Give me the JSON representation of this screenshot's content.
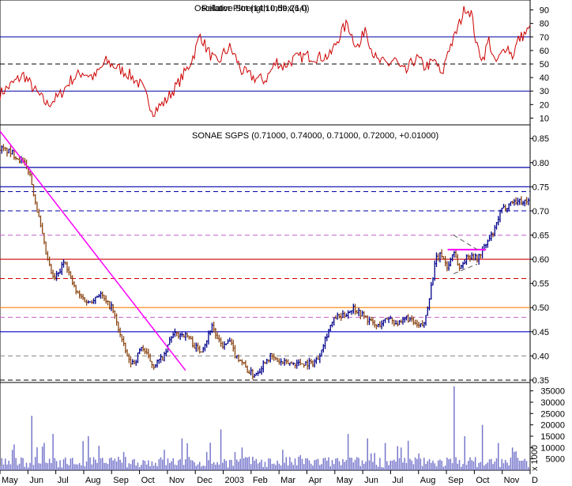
{
  "chart_data": [
    {
      "panel": "rsi",
      "type": "line",
      "title": "Relative Strength Index(14)",
      "title_overlay": "Oscillator Plot (14,10,59,26,0)",
      "ylim": [
        5,
        95
      ],
      "yticks": [
        "90",
        "80",
        "70",
        "60",
        "50",
        "40",
        "30",
        "20",
        "10"
      ],
      "hlines": [
        {
          "y": 70,
          "style": "solid",
          "color": "#0000aa"
        },
        {
          "y": 50,
          "style": "dashed",
          "color": "#000000"
        },
        {
          "y": 30,
          "style": "solid",
          "color": "#0000aa"
        }
      ],
      "color": "#cc0000",
      "key_points": [
        [
          0,
          28
        ],
        [
          4,
          35
        ],
        [
          8,
          42
        ],
        [
          12,
          30
        ],
        [
          16,
          20
        ],
        [
          20,
          26
        ],
        [
          24,
          38
        ],
        [
          28,
          44
        ],
        [
          32,
          40
        ],
        [
          36,
          52
        ],
        [
          40,
          47
        ],
        [
          44,
          42
        ],
        [
          48,
          34
        ],
        [
          52,
          15
        ],
        [
          56,
          22
        ],
        [
          60,
          34
        ],
        [
          64,
          48
        ],
        [
          66,
          58
        ],
        [
          68,
          72
        ],
        [
          70,
          62
        ],
        [
          72,
          55
        ],
        [
          74,
          50
        ],
        [
          76,
          58
        ],
        [
          78,
          62
        ],
        [
          80,
          55
        ],
        [
          82,
          45
        ],
        [
          86,
          40
        ],
        [
          90,
          38
        ],
        [
          94,
          52
        ],
        [
          96,
          48
        ],
        [
          100,
          54
        ],
        [
          104,
          56
        ],
        [
          108,
          55
        ],
        [
          112,
          56
        ],
        [
          116,
          74
        ],
        [
          118,
          80
        ],
        [
          120,
          68
        ],
        [
          122,
          62
        ],
        [
          124,
          78
        ],
        [
          126,
          62
        ],
        [
          128,
          52
        ],
        [
          132,
          50
        ],
        [
          134,
          54
        ],
        [
          136,
          46
        ],
        [
          138,
          44
        ],
        [
          140,
          52
        ],
        [
          142,
          54
        ],
        [
          144,
          48
        ],
        [
          148,
          52
        ],
        [
          150,
          40
        ],
        [
          152,
          60
        ],
        [
          154,
          68
        ],
        [
          156,
          80
        ],
        [
          158,
          92
        ],
        [
          160,
          88
        ],
        [
          162,
          62
        ],
        [
          164,
          54
        ],
        [
          166,
          68
        ],
        [
          168,
          50
        ],
        [
          170,
          56
        ],
        [
          172,
          64
        ],
        [
          174,
          56
        ],
        [
          176,
          68
        ],
        [
          178,
          72
        ],
        [
          180,
          76
        ]
      ]
    },
    {
      "panel": "price",
      "type": "ohlc",
      "title": "SONAE SGPS (0.71000, 0.74000, 0.71000, 0.72000, +0.01000)",
      "ylim": [
        0.345,
        0.865
      ],
      "yticks": [
        "0.85",
        "0.80",
        "0.75",
        "0.70",
        "0.65",
        "0.60",
        "0.55",
        "0.50",
        "0.45",
        "0.40",
        "0.35"
      ],
      "up_color": "#00008b",
      "down_color": "#8b4513",
      "key_points": [
        [
          0,
          0.83
        ],
        [
          4,
          0.82
        ],
        [
          8,
          0.8
        ],
        [
          10,
          0.78
        ],
        [
          12,
          0.72
        ],
        [
          14,
          0.66
        ],
        [
          16,
          0.6
        ],
        [
          18,
          0.56
        ],
        [
          20,
          0.57
        ],
        [
          22,
          0.6
        ],
        [
          24,
          0.56
        ],
        [
          26,
          0.53
        ],
        [
          28,
          0.52
        ],
        [
          30,
          0.51
        ],
        [
          32,
          0.52
        ],
        [
          34,
          0.53
        ],
        [
          36,
          0.51
        ],
        [
          38,
          0.5
        ],
        [
          40,
          0.46
        ],
        [
          42,
          0.42
        ],
        [
          44,
          0.385
        ],
        [
          46,
          0.39
        ],
        [
          48,
          0.42
        ],
        [
          50,
          0.4
        ],
        [
          52,
          0.38
        ],
        [
          54,
          0.39
        ],
        [
          56,
          0.4
        ],
        [
          58,
          0.44
        ],
        [
          60,
          0.445
        ],
        [
          62,
          0.445
        ],
        [
          64,
          0.44
        ],
        [
          66,
          0.42
        ],
        [
          68,
          0.41
        ],
        [
          70,
          0.43
        ],
        [
          72,
          0.465
        ],
        [
          74,
          0.43
        ],
        [
          76,
          0.42
        ],
        [
          78,
          0.43
        ],
        [
          80,
          0.4
        ],
        [
          82,
          0.39
        ],
        [
          84,
          0.37
        ],
        [
          86,
          0.36
        ],
        [
          88,
          0.37
        ],
        [
          90,
          0.39
        ],
        [
          92,
          0.4
        ],
        [
          94,
          0.39
        ],
        [
          96,
          0.385
        ],
        [
          98,
          0.385
        ],
        [
          100,
          0.385
        ],
        [
          102,
          0.385
        ],
        [
          104,
          0.385
        ],
        [
          106,
          0.385
        ],
        [
          108,
          0.395
        ],
        [
          110,
          0.43
        ],
        [
          112,
          0.46
        ],
        [
          114,
          0.48
        ],
        [
          116,
          0.48
        ],
        [
          118,
          0.49
        ],
        [
          120,
          0.5
        ],
        [
          122,
          0.49
        ],
        [
          124,
          0.48
        ],
        [
          126,
          0.47
        ],
        [
          128,
          0.46
        ],
        [
          130,
          0.47
        ],
        [
          132,
          0.48
        ],
        [
          134,
          0.47
        ],
        [
          136,
          0.465
        ],
        [
          138,
          0.48
        ],
        [
          140,
          0.47
        ],
        [
          142,
          0.46
        ],
        [
          144,
          0.465
        ],
        [
          146,
          0.53
        ],
        [
          148,
          0.6
        ],
        [
          150,
          0.61
        ],
        [
          152,
          0.58
        ],
        [
          154,
          0.62
        ],
        [
          156,
          0.58
        ],
        [
          158,
          0.6
        ],
        [
          160,
          0.61
        ],
        [
          162,
          0.6
        ],
        [
          164,
          0.62
        ],
        [
          166,
          0.64
        ],
        [
          168,
          0.66
        ],
        [
          170,
          0.7
        ],
        [
          172,
          0.71
        ],
        [
          174,
          0.72
        ]
      ],
      "hlines": [
        {
          "y": 0.79,
          "color": "#0000aa",
          "style": "solid"
        },
        {
          "y": 0.75,
          "color": "#0000aa",
          "style": "solid"
        },
        {
          "y": 0.74,
          "color": "#0000aa",
          "style": "dashed"
        },
        {
          "y": 0.7,
          "color": "#0000aa",
          "style": "dashed"
        },
        {
          "y": 0.65,
          "color": "#cc66cc",
          "style": "dashed"
        },
        {
          "y": 0.6,
          "color": "#cc0000",
          "style": "solid"
        },
        {
          "y": 0.56,
          "color": "#cc0000",
          "style": "dashed"
        },
        {
          "y": 0.5,
          "color": "#ff8000",
          "style": "solid"
        },
        {
          "y": 0.48,
          "color": "#cc66cc",
          "style": "dashed"
        },
        {
          "y": 0.45,
          "color": "#0000cc",
          "style": "solid"
        },
        {
          "y": 0.4,
          "color": "#888888",
          "style": "dashed"
        },
        {
          "y": 0.35,
          "color": "#000000",
          "style": "dashed"
        }
      ],
      "trendline": {
        "from": [
          0,
          0.865
        ],
        "to": [
          63,
          0.37
        ],
        "color": "#ff00ff"
      },
      "pattern_lines": [
        {
          "from": [
            152,
            0.62
          ],
          "to": [
            165,
            0.62
          ],
          "color": "#ff00ff"
        },
        {
          "from": [
            154,
            0.65
          ],
          "to": [
            162,
            0.62
          ],
          "color": "#555555",
          "style": "dashed"
        },
        {
          "from": [
            154,
            0.57
          ],
          "to": [
            162,
            0.59
          ],
          "color": "#555555",
          "style": "dashed"
        }
      ]
    },
    {
      "panel": "volume",
      "type": "bar",
      "title": "x 1000",
      "ylim": [
        0,
        38000
      ],
      "yticks": [
        "35000",
        "30000",
        "25000",
        "20000",
        "15000",
        "10000",
        "5000"
      ],
      "color": "#7777cc",
      "base_level": 4000,
      "spikes": [
        [
          4,
          9000
        ],
        [
          11,
          24000
        ],
        [
          15,
          12000
        ],
        [
          18,
          16000
        ],
        [
          30,
          15000
        ],
        [
          42,
          8000
        ],
        [
          56,
          9000
        ],
        [
          62,
          14000
        ],
        [
          70,
          8000
        ],
        [
          75,
          18000
        ],
        [
          80,
          8000
        ],
        [
          96,
          9000
        ],
        [
          118,
          16000
        ],
        [
          125,
          14000
        ],
        [
          131,
          12000
        ],
        [
          136,
          10000
        ],
        [
          154,
          37000
        ],
        [
          158,
          15000
        ],
        [
          164,
          20000
        ],
        [
          169,
          12000
        ],
        [
          174,
          10000
        ]
      ]
    }
  ],
  "x_axis": {
    "months": [
      "May",
      "Jun",
      "Jul",
      "Aug",
      "Sep",
      "Oct",
      "Nov",
      "Dec",
      "2003",
      "Feb",
      "Mar",
      "Apr",
      "May",
      "Jun",
      "Jul",
      "Aug",
      "Sep",
      "Oct",
      "Nov",
      "D"
    ],
    "span": 180
  }
}
